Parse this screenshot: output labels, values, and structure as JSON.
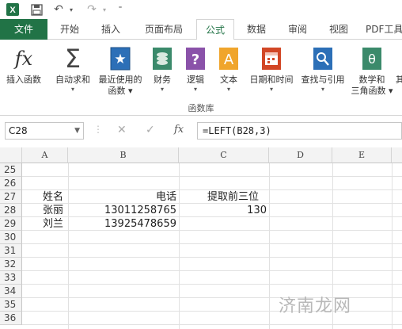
{
  "tabs": [
    "文件",
    "开始",
    "插入",
    "页面布局",
    "公式",
    "数据",
    "审阅",
    "视图",
    "PDF工具"
  ],
  "ribbon": {
    "buttons": [
      {
        "line1": "插入函数",
        "line2": "",
        "icon": "insert-function-icon"
      },
      {
        "line1": "自动求和",
        "line2": "▾",
        "icon": "sigma-icon"
      },
      {
        "line1": "最近使用的",
        "line2": "函数 ▾",
        "icon": "recent-star-icon"
      },
      {
        "line1": "财务",
        "line2": "▾",
        "icon": "finance-coins-icon"
      },
      {
        "line1": "逻辑",
        "line2": "▾",
        "icon": "logic-question-icon"
      },
      {
        "line1": "文本",
        "line2": "▾",
        "icon": "text-a-icon"
      },
      {
        "line1": "日期和时间",
        "line2": "▾",
        "icon": "date-time-calendar-icon"
      },
      {
        "line1": "查找与引用",
        "line2": "▾",
        "icon": "lookup-magnifier-icon"
      },
      {
        "line1": "数学和",
        "line2": "三角函数 ▾",
        "icon": "math-theta-icon"
      },
      {
        "line1": "其",
        "line2": "",
        "icon": "more-functions-icon"
      }
    ],
    "group_label": "函数库",
    "fx_symbol": "fx",
    "sigma": "Σ",
    "star": "★",
    "question": "?",
    "letter_a": "A",
    "theta": "θ"
  },
  "formula_bar": {
    "name_box": "C28",
    "cancel_glyph": "✕",
    "enter_glyph": "✓",
    "fx_glyph": "fx",
    "formula": "=LEFT(B28,3)"
  },
  "columns": [
    "A",
    "B",
    "C",
    "D",
    "E"
  ],
  "rows": [
    "25",
    "26",
    "27",
    "28",
    "29",
    "30",
    "31",
    "32",
    "33",
    "34",
    "35",
    "36"
  ],
  "cells": {
    "a27": "姓名",
    "b27": "电话",
    "c27": "提取前三位",
    "a28": "张丽",
    "b28": "13011258765",
    "c28": "130",
    "a29": "刘兰",
    "b29": "13925478659"
  },
  "watermark": "济南龙网",
  "colors": {
    "accent": "#217346",
    "grid": "#e1e1e1",
    "header_bg": "#f3f3f3"
  }
}
